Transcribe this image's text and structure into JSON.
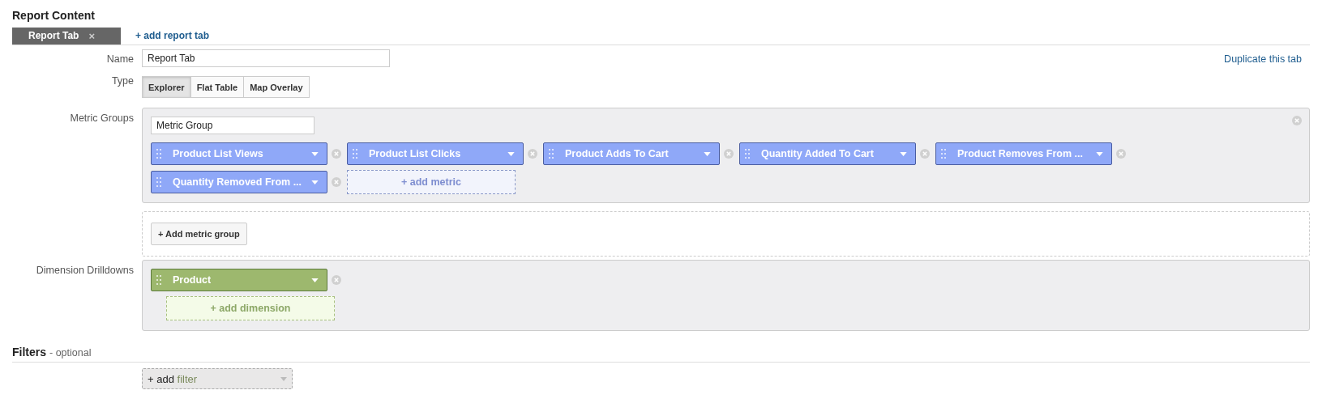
{
  "heading": "Report Content",
  "tabs": [
    {
      "label": "Report Tab",
      "close": "×",
      "selected": true
    }
  ],
  "add_tab": "+ add report tab",
  "name_field": {
    "label": "Name",
    "value": "Report Tab"
  },
  "duplicate_link": "Duplicate this tab",
  "type": {
    "label": "Type",
    "options": [
      {
        "label": "Explorer",
        "selected": true
      },
      {
        "label": "Flat Table",
        "selected": false
      },
      {
        "label": "Map Overlay",
        "selected": false
      }
    ]
  },
  "metric_groups": {
    "label": "Metric Groups",
    "groups": [
      {
        "name": "Metric Group",
        "metrics": [
          {
            "label": "Product List Views"
          },
          {
            "label": "Product List Clicks"
          },
          {
            "label": "Product Adds To Cart"
          },
          {
            "label": "Quantity Added To Cart"
          },
          {
            "label": "Product Removes From ..."
          },
          {
            "label": "Quantity Removed From ..."
          }
        ],
        "add": "+ add metric"
      }
    ],
    "add_group": "+ Add metric group"
  },
  "dimensions": {
    "label": "Dimension Drilldowns",
    "items": [
      {
        "label": "Product"
      }
    ],
    "add": "+ add dimension"
  },
  "filters": {
    "heading": "Filters",
    "note": "- optional",
    "add_prefix": "+ add",
    "add_label": "filter"
  }
}
